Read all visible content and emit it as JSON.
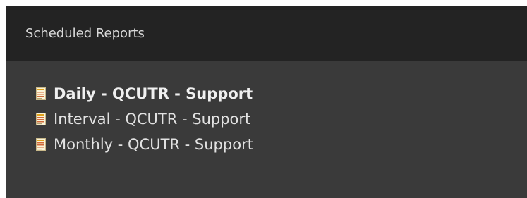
{
  "panel": {
    "title": "Scheduled Reports"
  },
  "reports": [
    {
      "label": "Daily - QCUTR - Support",
      "icon": "report-document-icon",
      "bold": true
    },
    {
      "label": "Interval - QCUTR - Support",
      "icon": "report-document-icon",
      "bold": false
    },
    {
      "label": "Monthly - QCUTR - Support",
      "icon": "report-document-icon",
      "bold": false
    }
  ],
  "colors": {
    "header_bg": "#232323",
    "panel_bg": "#3a3a3a",
    "text": "#e2e2e2",
    "icon_paper": "#fbf4d8",
    "icon_accent": "#e0a21a"
  }
}
